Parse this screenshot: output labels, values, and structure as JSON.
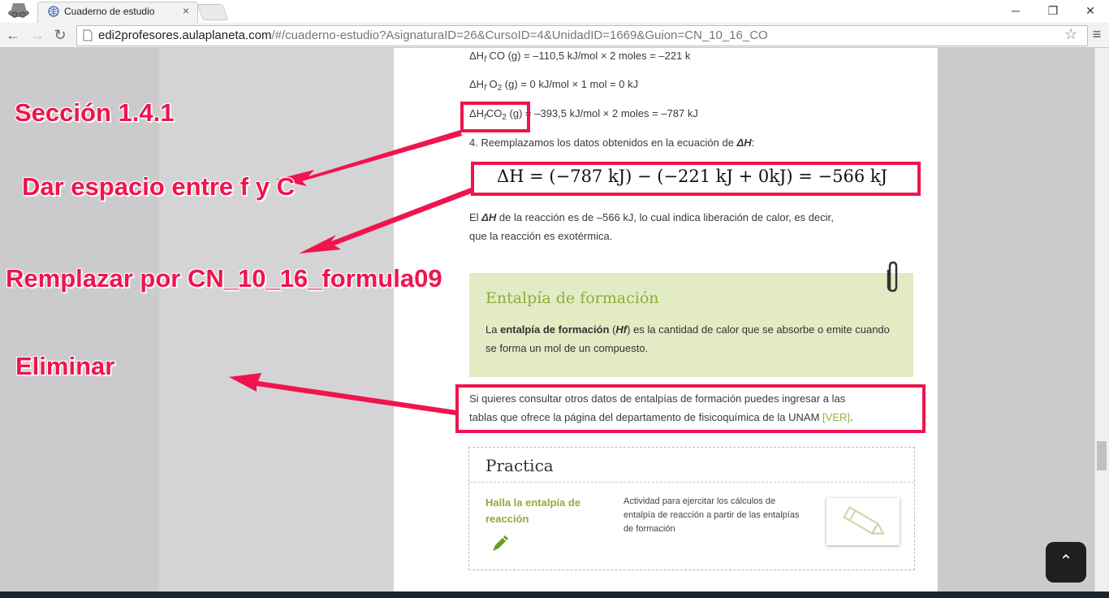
{
  "browser": {
    "tab_title": "Cuaderno de estudio",
    "url_host": "edi2profesores.aulaplaneta.com",
    "url_path": "/#/cuaderno-estudio?AsignaturaID=26&CursoID=4&UnidadID=1669&Guion=CN_10_16_CO",
    "icons": [
      "incognito-icon",
      "globe-icon",
      "back-icon",
      "forward-icon",
      "reload-icon",
      "page-icon",
      "star-icon",
      "menu-icon"
    ]
  },
  "content": {
    "line_co": {
      "prefix": "ΔH",
      "sub": "f",
      "mid": " CO (g) = –110,5 kJ/mol × 2 moles = –221 k"
    },
    "line_o2": {
      "prefix": "ΔH",
      "sub": "f",
      "mid": " O",
      "sub2": "2",
      "rest": " (g) = 0 kJ/mol × 1 mol = 0 kJ"
    },
    "line_co2": {
      "prefix": "ΔH",
      "sub": "f",
      "mid": "CO",
      "sub2": "2",
      "rest": " (g) = –393,5 kJ/mol × 2 moles = –787 kJ"
    },
    "step4": {
      "text": "4. Reemplazamos los datos obtenidos en la ecuación de ",
      "bold": "ΔH",
      "end": ":"
    },
    "formula": "ΔH = (−787 kJ) − (−221 kJ + 0kJ) = −566 kJ",
    "result": {
      "l1a": "El ",
      "l1b": "ΔH",
      "l1c": " de la reacción es de –566 kJ, lo cual indica liberación de calor, es decir,",
      "l2": "que la reacción es exotérmica."
    },
    "definition": {
      "title": "Entalpía de formación",
      "t1": "La ",
      "t2": "entalpía de formación",
      "t3": " (",
      "t4": "Hf",
      "t5": ") es la cantidad de calor que se absorbe o emite cuando se forma un mol de un compuesto."
    },
    "consult": {
      "l1": "Si quieres consultar otros datos de entalpías de formación puedes ingresar a las",
      "l2": "tablas que ofrece la página del departamento de fisicoquímica de la UNAM ",
      "link": "[VER]",
      "end": "."
    },
    "practica": {
      "title": "Practica",
      "activity_title": "Halla la entalpía de reacción",
      "activity_desc": "Actividad para ejercitar los cálculos de entalpía de reacción a partir de las entalpías de formación"
    },
    "scroll_top": "⌃"
  },
  "annotations": {
    "a1": "Sección 1.4.1",
    "a2": "Dar espacio entre f y C",
    "a3": "Remplazar por CN_10_16_formula09",
    "a4": "Eliminar"
  },
  "colors": {
    "annotation": "#f0144e",
    "accent_green": "#8fad3a",
    "definition_bg": "#e2ebc4"
  }
}
